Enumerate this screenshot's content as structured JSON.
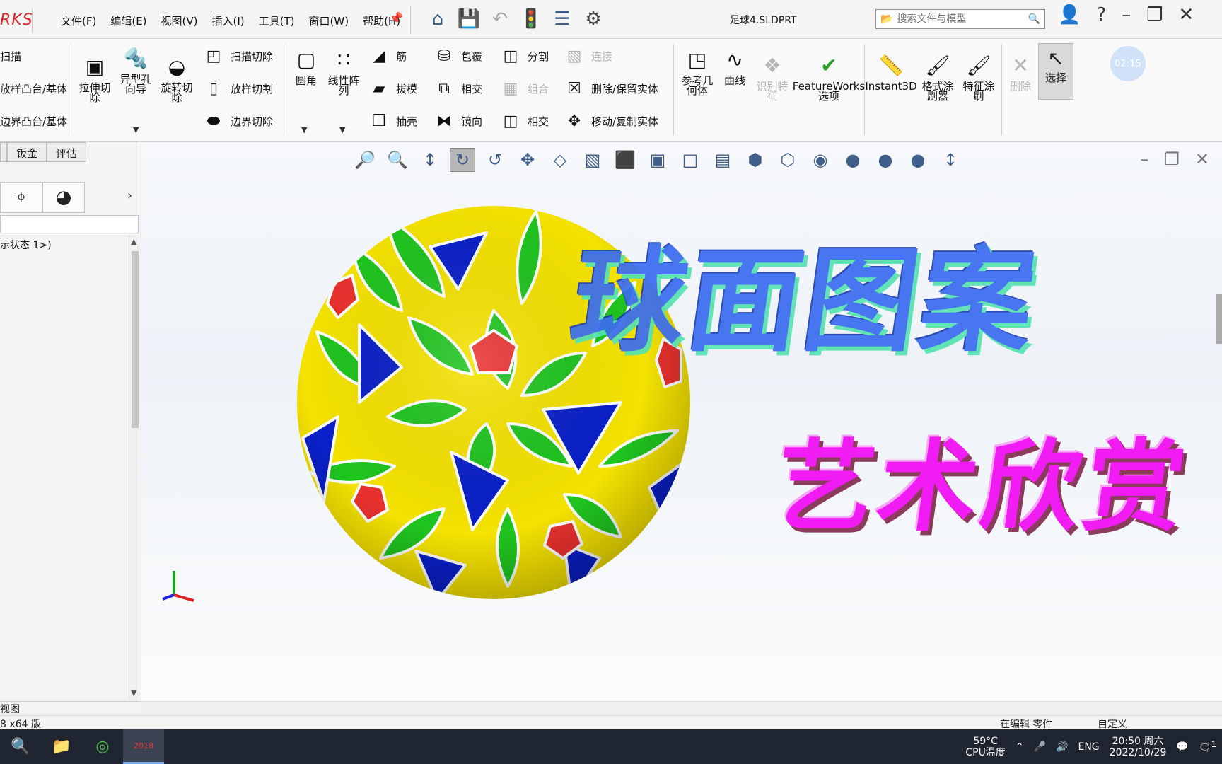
{
  "app": {
    "logo_text": "RKS",
    "document_title": "足球4.SLDPRT"
  },
  "menu": [
    "文件(F)",
    "编辑(E)",
    "视图(V)",
    "插入(I)",
    "工具(T)",
    "窗口(W)",
    "帮助(H)"
  ],
  "search": {
    "placeholder": "搜索文件与模型"
  },
  "ribbon": {
    "left_items": [
      "扫描",
      "放样凸台/基体",
      "边界凸台/基体"
    ],
    "cut_extrude": "拉伸切除",
    "hole_wizard": "异型孔向导",
    "revolve_cut": "旋转切除",
    "sweep_cut": "扫描切除",
    "loft_cut": "放样切割",
    "boundary_cut": "边界切除",
    "fillet": "圆角",
    "linear_pattern": "线性阵列",
    "rib": "筋",
    "draft": "拔模",
    "shell": "抽壳",
    "wrap": "包覆",
    "intersect": "相交",
    "mirror": "镜向",
    "split": "分割",
    "combine": "组合",
    "intersect2": "相交",
    "join": "连接",
    "delete_keep_body": "删除/保留实体",
    "move_copy_body": "移动/复制实体",
    "ref_geometry": "参考几何体",
    "curves": "曲线",
    "recognize": "识别特征",
    "featureworks": "FeatureWorks选项",
    "instant3d": "Instant3D",
    "format_painter": "格式涂刷器",
    "feature_painter": "特征涂刷",
    "delete": "删除",
    "select": "选择",
    "timer": "02:15"
  },
  "left_panel": {
    "tabs": [
      "",
      "钣金",
      "评估"
    ],
    "tree_item": "示状态 1>)"
  },
  "overlay": {
    "title": "球面图案",
    "subtitle": "艺术欣赏"
  },
  "status": {
    "bottom_tab": "视图",
    "left": "8 x64 版",
    "editing": "在编辑 零件",
    "custom": "自定义"
  },
  "taskbar": {
    "temp_value": "59°C",
    "temp_label": "CPU温度",
    "lang": "ENG",
    "time": "20:50 周六",
    "date": "2022/10/29",
    "notification_count": "1",
    "sw_label": "2018"
  },
  "colors": {
    "ball_yellow": "#f4e200",
    "ball_green": "#1fc41f",
    "ball_blue": "#0a20c8",
    "ball_red": "#e8312e",
    "overlay_title": "#3a6cf0",
    "overlay_subtitle": "#f11cf4"
  }
}
